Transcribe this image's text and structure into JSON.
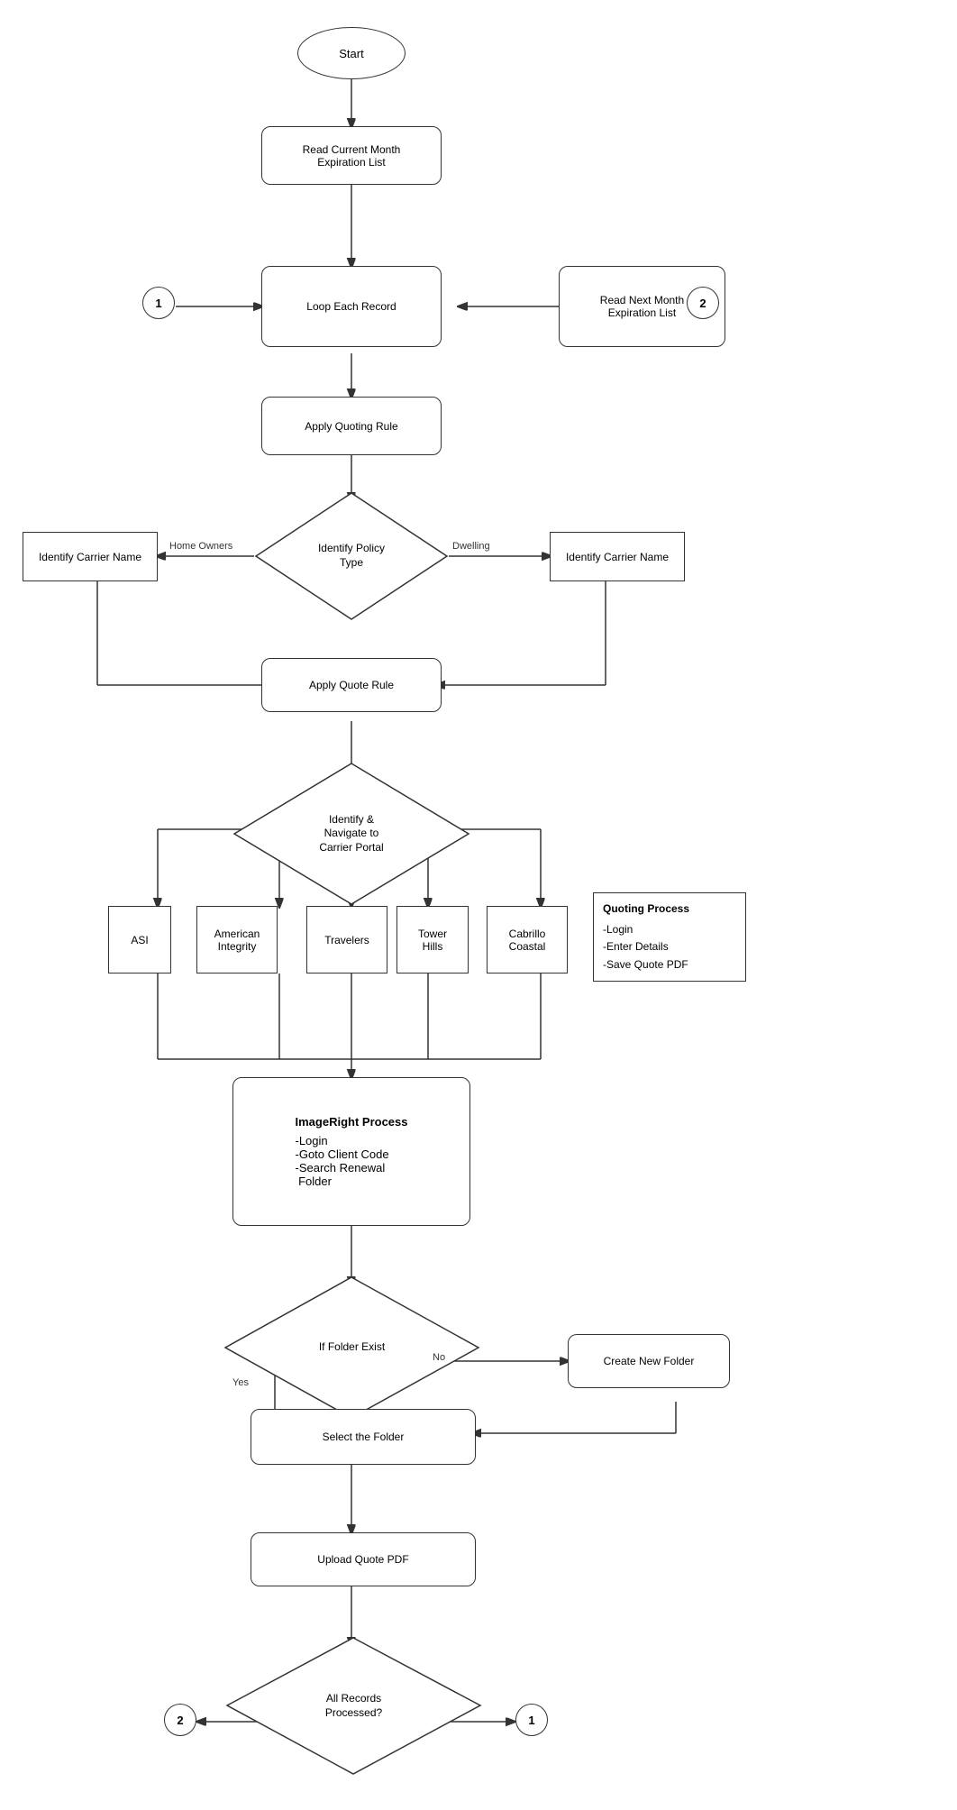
{
  "shapes": {
    "start": {
      "label": "Start"
    },
    "read_current": {
      "label": "Read Current Month\nExpiration List"
    },
    "loop_each": {
      "label": "Loop Each Record"
    },
    "read_next": {
      "label": "Read Next Month\nExpiration List"
    },
    "apply_quoting": {
      "label": "Apply Quoting Rule"
    },
    "identify_policy": {
      "label": "Identify Policy\nType"
    },
    "identify_carrier_left": {
      "label": "Identify Carrier Name"
    },
    "identify_carrier_right": {
      "label": "Identify Carrier Name"
    },
    "apply_quote": {
      "label": "Apply Quote Rule"
    },
    "identify_navigate": {
      "label": "Identify &\nNavigate to\nCarrier Portal"
    },
    "asi": {
      "label": "ASI"
    },
    "american_integrity": {
      "label": "American\nIntegrity"
    },
    "travelers": {
      "label": "Travelers"
    },
    "tower_hills": {
      "label": "Tower\nHills"
    },
    "cabrillo_coastal": {
      "label": "Cabrillo\nCoastal"
    },
    "quoting_process": {
      "title": "Quoting Process",
      "lines": [
        "-Login",
        "-Enter Details",
        "-Save Quote PDF"
      ]
    },
    "imageright_process": {
      "title": "ImageRight Process",
      "lines": [
        "-Login",
        "-Goto Client Code",
        "-Search Renewal\nFolder"
      ]
    },
    "if_folder_exist": {
      "label": "If Folder Exist"
    },
    "create_new_folder": {
      "label": "Create New Folder"
    },
    "select_folder": {
      "label": "Select the Folder"
    },
    "upload_quote": {
      "label": "Upload Quote PDF"
    },
    "all_records": {
      "label": "All Records\nProcessed?"
    },
    "connector1_top": {
      "label": "1"
    },
    "connector2_top": {
      "label": "2"
    },
    "connector1_bottom": {
      "label": "1"
    },
    "connector2_bottom": {
      "label": "2"
    },
    "labels": {
      "home_owners": "Home Owners",
      "dwelling": "Dwelling",
      "yes": "Yes",
      "no": "No"
    }
  }
}
